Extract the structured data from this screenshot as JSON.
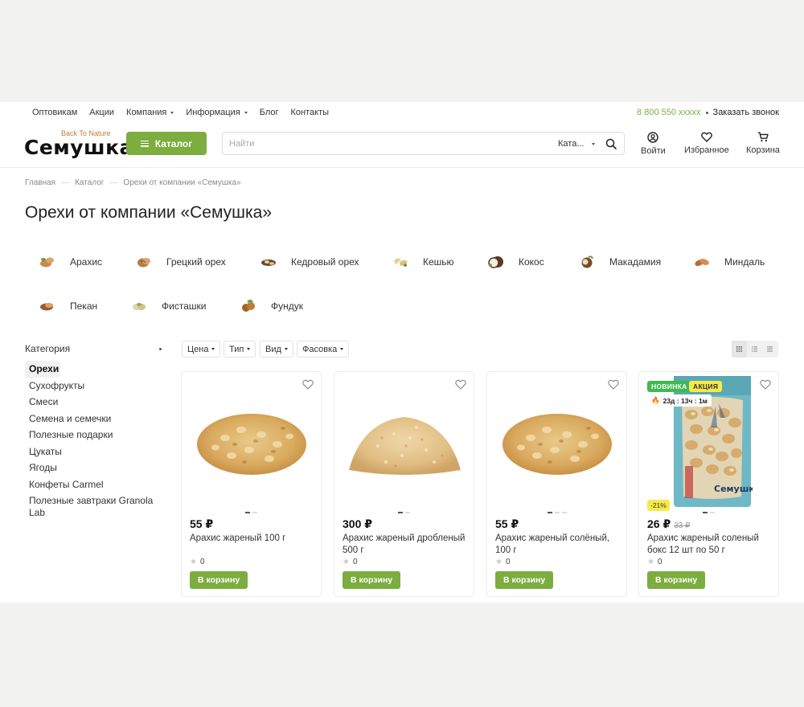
{
  "topnav": {
    "items": [
      {
        "label": "Оптовикам",
        "dropdown": false
      },
      {
        "label": "Акции",
        "dropdown": false
      },
      {
        "label": "Компания",
        "dropdown": true
      },
      {
        "label": "Информация",
        "dropdown": true
      },
      {
        "label": "Блог",
        "dropdown": false
      },
      {
        "label": "Контакты",
        "dropdown": false
      }
    ],
    "phone": "8 800 550 xxxxx",
    "callback": "Заказать звонок"
  },
  "header": {
    "logo_text": "Семушка",
    "logo_tagline": "Back To Nature",
    "catalog_button": "Каталог",
    "search_placeholder": "Найти",
    "search_category": "Ката...",
    "login": "Войти",
    "favorites": "Избранное",
    "cart": "Корзина"
  },
  "breadcrumb": [
    "Главная",
    "Каталог",
    "Орехи от компании «Семушка»"
  ],
  "page_title": "Орехи от компании «Семушка»",
  "subcategories": [
    "Арахис",
    "Грецкий орех",
    "Кедровый орех",
    "Кешью",
    "Кокос",
    "Макадамия",
    "Миндаль",
    "Пекан",
    "Фисташки",
    "Фундук"
  ],
  "sidebar": {
    "title": "Категория",
    "items": [
      "Орехи",
      "Сухофрукты",
      "Смеси",
      "Семена и семечки",
      "Полезные подарки",
      "Цукаты",
      "Ягоды",
      "Конфеты Carmel",
      "Полезные завтраки Granola Lab"
    ],
    "active_index": 0
  },
  "filters": [
    "Цена",
    "Тип",
    "Вид",
    "Фасовка"
  ],
  "view_modes": [
    "grid-icon",
    "list-icon",
    "table-icon"
  ],
  "products": [
    {
      "price": "55 ₽",
      "old_price": "",
      "name": "Арахис жареный 100 г",
      "rating": "0",
      "button": "В корзину",
      "image": "peanuts-whole"
    },
    {
      "price": "300 ₽",
      "old_price": "",
      "name": "Арахис жареный дробленый 500 г",
      "rating": "0",
      "button": "В корзину",
      "image": "peanuts-crushed"
    },
    {
      "price": "55 ₽",
      "old_price": "",
      "name": "Арахис жареный солёный, 100 г",
      "rating": "0",
      "button": "В корзину",
      "image": "peanuts-whole"
    },
    {
      "price": "26 ₽",
      "old_price": "33 ₽",
      "name": "Арахис жареный соленый бокс 12 шт по 50 г",
      "rating": "0",
      "button": "В корзину",
      "image": "peanut-bag",
      "badge_new": "НОВИНКА",
      "badge_sale": "АКЦИЯ",
      "timer": "23д : 13ч : 1м",
      "discount": "-21%"
    }
  ],
  "colors": {
    "accent": "#7cad3e",
    "badge_new": "#3fb950",
    "badge_sale": "#f6ea4b",
    "background": "#f2f2f1"
  }
}
